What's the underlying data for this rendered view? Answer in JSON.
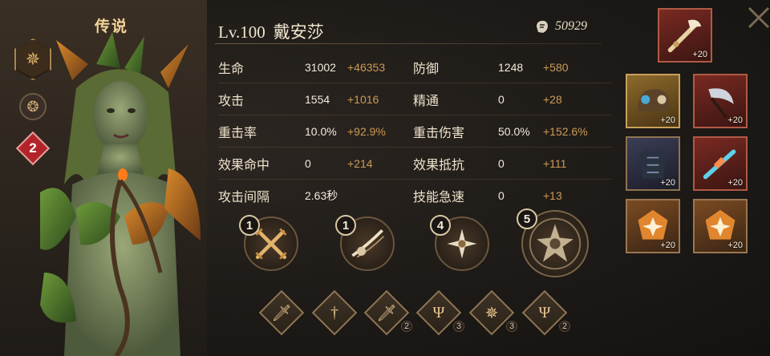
{
  "hero": {
    "rarity": "传说",
    "level": "Lv.100",
    "name": "戴安莎",
    "power": "50929",
    "star_level": "2"
  },
  "stats": [
    {
      "label": "生命",
      "base": "31002",
      "bonus": "+46353"
    },
    {
      "label": "防御",
      "base": "1248",
      "bonus": "+580"
    },
    {
      "label": "攻击",
      "base": "1554",
      "bonus": "+1016"
    },
    {
      "label": "精通",
      "base": "0",
      "bonus": "+28"
    },
    {
      "label": "重击率",
      "base": "10.0%",
      "bonus": "+92.9%"
    },
    {
      "label": "重击伤害",
      "base": "50.0%",
      "bonus": "+152.6%"
    },
    {
      "label": "效果命中",
      "base": "0",
      "bonus": "+214"
    },
    {
      "label": "效果抵抗",
      "base": "0",
      "bonus": "+111"
    },
    {
      "label": "攻击间隔",
      "base": "2.63秒",
      "bonus": ""
    },
    {
      "label": "技能急速",
      "base": "0",
      "bonus": "+13"
    }
  ],
  "skills": [
    {
      "level": "1",
      "icon": "crossed-swords-icon"
    },
    {
      "level": "1",
      "icon": "slash-strike-icon"
    },
    {
      "level": "4",
      "icon": "burst-flower-icon"
    },
    {
      "level": "5",
      "icon": "ultimate-nature-icon"
    }
  ],
  "passives": [
    {
      "icon": "sword-icon",
      "count": ""
    },
    {
      "icon": "sword-upright-icon",
      "count": ""
    },
    {
      "icon": "sword-icon",
      "count": "2"
    },
    {
      "icon": "trident-icon",
      "count": "3"
    },
    {
      "icon": "star-compass-icon",
      "count": "3"
    },
    {
      "icon": "trident-icon",
      "count": "2"
    }
  ],
  "equipment": [
    {
      "slot": "weapon",
      "plus": "+20",
      "icon": "ornate-sword-icon"
    },
    {
      "slot": "helmet",
      "plus": "+20",
      "icon": "helmet-icon"
    },
    {
      "slot": "scythe",
      "plus": "+20",
      "icon": "scythe-icon"
    },
    {
      "slot": "armor",
      "plus": "+20",
      "icon": "armor-icon"
    },
    {
      "slot": "offhand",
      "plus": "+20",
      "icon": "blade-icon"
    },
    {
      "slot": "gem-1",
      "plus": "+20",
      "icon": "gem-icon"
    },
    {
      "slot": "gem-2",
      "plus": "+20",
      "icon": "gem-icon"
    }
  ]
}
